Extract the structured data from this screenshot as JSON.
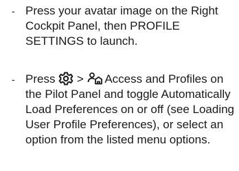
{
  "instructions": [
    {
      "dash": "-",
      "text": "Press your avatar image on the Right Cockpit Panel, then PROFILE SETTINGS to launch."
    },
    {
      "dash": "-",
      "text_before_gear": "Press ",
      "gear_icon": "gear-icon",
      "separator": " > ",
      "profiles_icon": "user-profiles-icon",
      "text_after_icons": " Access and Profiles on the Pilot Panel and toggle Automatically Load Preferences on or off (see Loading User Profile Preferences), or select an option from the listed menu options."
    }
  ]
}
